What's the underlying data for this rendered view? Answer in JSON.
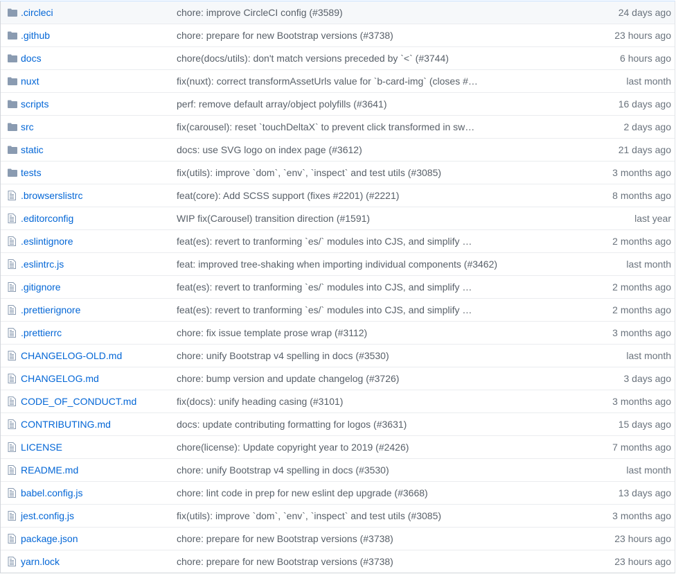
{
  "colors": {
    "link": "#0366d6",
    "folder": "#79b8ff",
    "text": "#586069"
  },
  "files": [
    {
      "type": "folder",
      "name": ".circleci",
      "message": "chore: improve CircleCI config (#3589)",
      "age": "24 days ago"
    },
    {
      "type": "folder",
      "name": ".github",
      "message": "chore: prepare for new Bootstrap versions (#3738)",
      "age": "23 hours ago"
    },
    {
      "type": "folder",
      "name": "docs",
      "message": "chore(docs/utils): don't match versions preceded by `<` (#3744)",
      "age": "6 hours ago"
    },
    {
      "type": "folder",
      "name": "nuxt",
      "message": "fix(nuxt): correct transformAssetUrls value for `b-card-img` (closes #…",
      "age": "last month"
    },
    {
      "type": "folder",
      "name": "scripts",
      "message": "perf: remove default array/object polyfills (#3641)",
      "age": "16 days ago"
    },
    {
      "type": "folder",
      "name": "src",
      "message": "fix(carousel): reset `touchDeltaX` to prevent click transformed in sw…",
      "age": "2 days ago"
    },
    {
      "type": "folder",
      "name": "static",
      "message": "docs: use SVG logo on index page (#3612)",
      "age": "21 days ago"
    },
    {
      "type": "folder",
      "name": "tests",
      "message": "fix(utils): improve `dom`, `env`, `inspect` and test utils (#3085)",
      "age": "3 months ago"
    },
    {
      "type": "file",
      "name": ".browserslistrc",
      "message": "feat(core): Add SCSS support (fixes #2201) (#2221)",
      "age": "8 months ago"
    },
    {
      "type": "file",
      "name": ".editorconfig",
      "message": "WIP fix(Carousel) transition direction (#1591)",
      "age": "last year"
    },
    {
      "type": "file",
      "name": ".eslintignore",
      "message": "feat(es): revert to tranforming `es/` modules into CJS, and simplify …",
      "age": "2 months ago"
    },
    {
      "type": "file",
      "name": ".eslintrc.js",
      "message": "feat: improved tree-shaking when importing individual components (#3462)",
      "age": "last month"
    },
    {
      "type": "file",
      "name": ".gitignore",
      "message": "feat(es): revert to tranforming `es/` modules into CJS, and simplify …",
      "age": "2 months ago"
    },
    {
      "type": "file",
      "name": ".prettierignore",
      "message": "feat(es): revert to tranforming `es/` modules into CJS, and simplify …",
      "age": "2 months ago"
    },
    {
      "type": "file",
      "name": ".prettierrc",
      "message": "chore: fix issue template prose wrap (#3112)",
      "age": "3 months ago"
    },
    {
      "type": "file",
      "name": "CHANGELOG-OLD.md",
      "message": "chore: unify Bootstrap v4 spelling in docs (#3530)",
      "age": "last month"
    },
    {
      "type": "file",
      "name": "CHANGELOG.md",
      "message": "chore: bump version and update changelog (#3726)",
      "age": "3 days ago"
    },
    {
      "type": "file",
      "name": "CODE_OF_CONDUCT.md",
      "message": "fix(docs): unify heading casing (#3101)",
      "age": "3 months ago"
    },
    {
      "type": "file",
      "name": "CONTRIBUTING.md",
      "message": "docs: update contributing formatting for logos (#3631)",
      "age": "15 days ago"
    },
    {
      "type": "file",
      "name": "LICENSE",
      "message": "chore(license): Update copyright year to 2019 (#2426)",
      "age": "7 months ago"
    },
    {
      "type": "file",
      "name": "README.md",
      "message": "chore: unify Bootstrap v4 spelling in docs (#3530)",
      "age": "last month"
    },
    {
      "type": "file",
      "name": "babel.config.js",
      "message": "chore: lint code in prep for new eslint dep upgrade (#3668)",
      "age": "13 days ago"
    },
    {
      "type": "file",
      "name": "jest.config.js",
      "message": "fix(utils): improve `dom`, `env`, `inspect` and test utils (#3085)",
      "age": "3 months ago"
    },
    {
      "type": "file",
      "name": "package.json",
      "message": "chore: prepare for new Bootstrap versions (#3738)",
      "age": "23 hours ago"
    },
    {
      "type": "file",
      "name": "yarn.lock",
      "message": "chore: prepare for new Bootstrap versions (#3738)",
      "age": "23 hours ago"
    }
  ]
}
